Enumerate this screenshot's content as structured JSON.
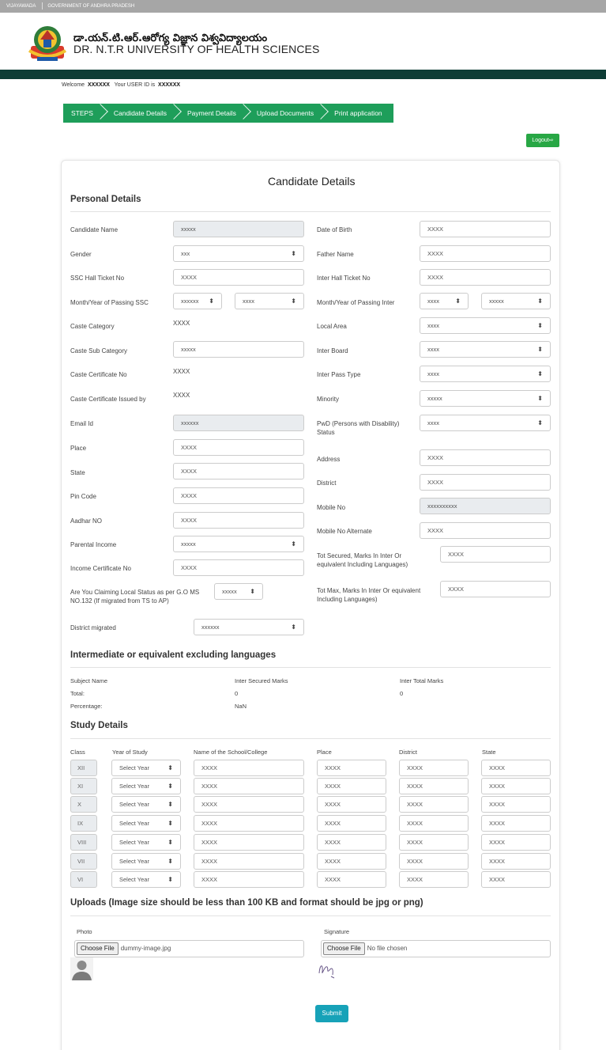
{
  "topbar": {
    "city": "VIJAYAWADA",
    "gov": "GOVERNMENT OF ANDHRA PRADESH"
  },
  "header": {
    "name_te": "డా.యన్.టి.ఆర్.ఆరోగ్య విజ్ఞాన విశ్వవిద్యాలయం",
    "name_en": "DR. N.T.R UNIVERSITY OF HEALTH SCIENCES"
  },
  "welcome": {
    "prefix": "Welcome",
    "user": "XXXXXX",
    "mid": "Your USER ID is",
    "uid": "XXXXXX"
  },
  "steps": [
    "STEPS",
    "Candidate Details",
    "Payment Details",
    "Upload Documents",
    "Print application"
  ],
  "logout": "Logout⇨",
  "form": {
    "title": "Candidate Details",
    "personal_title": "Personal Details",
    "left": [
      {
        "label": "Candidate Name",
        "value": "xxxxx"
      },
      {
        "label": "Gender",
        "value": "xxx"
      },
      {
        "label": "SSC Hall Ticket No",
        "value": "XXXX"
      },
      {
        "label": "Month/Year of Passing SSC",
        "value": "xxxxxx",
        "value2": "xxxx"
      },
      {
        "label": "Caste Category",
        "value": "XXXX"
      },
      {
        "label": "Caste Sub Category",
        "value": "xxxxx"
      },
      {
        "label": "Caste Certificate No",
        "value": "XXXX"
      },
      {
        "label": "Caste Certificate Issued by",
        "value": "XXXX"
      },
      {
        "label": "Email Id",
        "value": "xxxxxx"
      },
      {
        "label": "Place",
        "value": "XXXX"
      },
      {
        "label": "State",
        "value": "XXXX"
      },
      {
        "label": "Pin Code",
        "value": "XXXX"
      },
      {
        "label": "Aadhar NO",
        "value": "XXXX"
      },
      {
        "label": "Parental Income",
        "value": "xxxxx"
      },
      {
        "label": "Income Certificate No",
        "value": "XXXX"
      },
      {
        "label": "Are You Claiming Local Status as per G.O MS NO.132 (If migrated from TS to AP)",
        "value": "xxxxx"
      },
      {
        "label": "District migrated",
        "value": "xxxxxx"
      }
    ],
    "right": [
      {
        "label": "Date of Birth",
        "value": "XXXX"
      },
      {
        "label": "Father Name",
        "value": "XXXX"
      },
      {
        "label": "Inter Hall Ticket No",
        "value": "XXXX"
      },
      {
        "label": "Month/Year of Passing Inter",
        "value": "xxxx",
        "value2": "xxxxx"
      },
      {
        "label": "Local Area",
        "value": "xxxx"
      },
      {
        "label": "Inter Board",
        "value": "xxxx"
      },
      {
        "label": "Inter Pass Type",
        "value": "xxxx"
      },
      {
        "label": "Minority",
        "value": "xxxxx"
      },
      {
        "label": "PwD (Persons with Disability) Status",
        "value": "xxxx"
      },
      {
        "label": "Address",
        "value": "XXXX"
      },
      {
        "label": "District",
        "value": "XXXX"
      },
      {
        "label": "Mobile No",
        "value": "xxxxxxxxxx"
      },
      {
        "label": "Mobile No Alternate",
        "value": "XXXX"
      },
      {
        "label": "Tot Secured, Marks In Inter Or equivalent Including Languages)",
        "value": "XXXX"
      },
      {
        "label": "Tot Max, Marks In Inter Or equivalent Including Languages)",
        "value": "XXXX"
      }
    ],
    "inter_title": "Intermediate or equivalent excluding languages",
    "inter": {
      "h1": "Subject Name",
      "h2": "Inter Secured Marks",
      "h3": "Inter Total Marks",
      "total_label": "Total:",
      "total_secured": "0",
      "total_max": "0",
      "pct_label": "Percentage:",
      "pct_value": "NaN"
    },
    "study_title": "Study Details",
    "study_headers": [
      "Class",
      "Year of Study",
      "Name of the School/College",
      "Place",
      "District",
      "State"
    ],
    "study_rows": [
      {
        "cls": "XII",
        "year": "Select Year",
        "school": "XXXX",
        "place": "XXXX",
        "district": "XXXX",
        "state": "XXXX"
      },
      {
        "cls": "XI",
        "year": "Select Year",
        "school": "XXXX",
        "place": "XXXX",
        "district": "XXXX",
        "state": "XXXX"
      },
      {
        "cls": "X",
        "year": "Select Year",
        "school": "XXXX",
        "place": "XXXX",
        "district": "XXXX",
        "state": "XXXX"
      },
      {
        "cls": "IX",
        "year": "Select Year",
        "school": "XXXX",
        "place": "XXXX",
        "district": "XXXX",
        "state": "XXXX"
      },
      {
        "cls": "VIII",
        "year": "Select Year",
        "school": "XXXX",
        "place": "XXXX",
        "district": "XXXX",
        "state": "XXXX"
      },
      {
        "cls": "VII",
        "year": "Select Year",
        "school": "XXXX",
        "place": "XXXX",
        "district": "XXXX",
        "state": "XXXX"
      },
      {
        "cls": "VI",
        "year": "Select Year",
        "school": "XXXX",
        "place": "XXXX",
        "district": "XXXX",
        "state": "XXXX"
      }
    ],
    "uploads_title": "Uploads (Image size should be less than 100 KB and format should be jpg or png)",
    "photo": {
      "label": "Photo",
      "button": "Choose File",
      "file": "dummy-image.jpg"
    },
    "signature": {
      "label": "Signature",
      "button": "Choose File",
      "file": "No file chosen"
    },
    "submit": "Submit"
  }
}
